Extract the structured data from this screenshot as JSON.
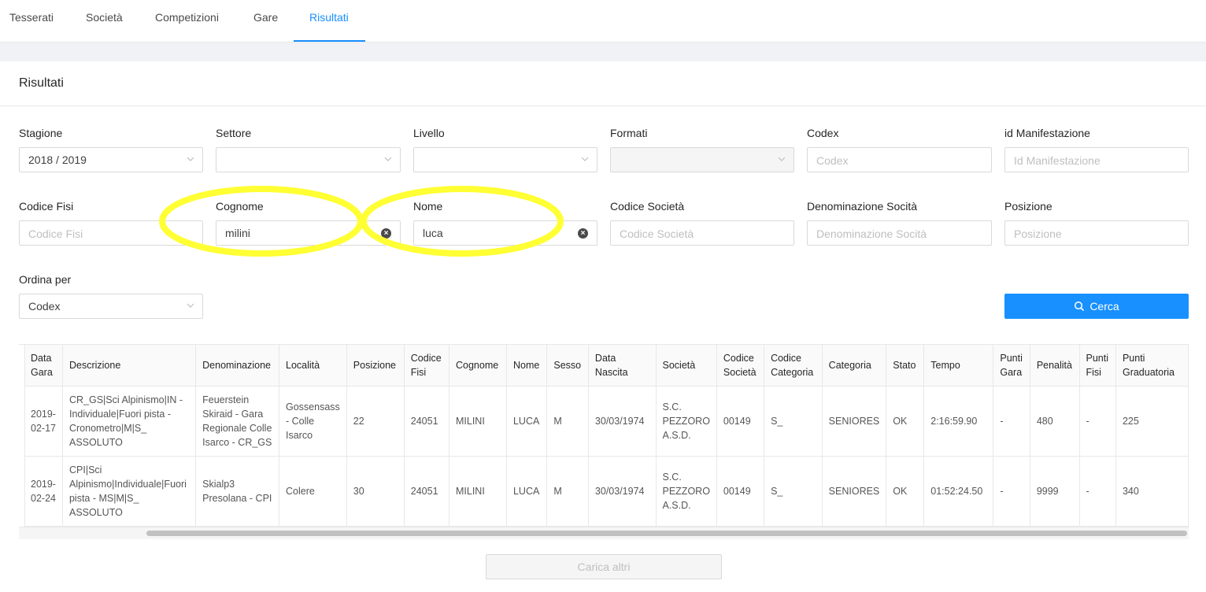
{
  "nav": {
    "tabs": [
      "Tesserati",
      "Società",
      "Competizioni",
      "Gare",
      "Risultati"
    ],
    "active": "Risultati"
  },
  "section_title": "Risultati",
  "filters": {
    "stagione": {
      "label": "Stagione",
      "value": "2018 / 2019"
    },
    "settore": {
      "label": "Settore",
      "value": ""
    },
    "livello": {
      "label": "Livello",
      "value": ""
    },
    "formati": {
      "label": "Formati",
      "value": ""
    },
    "codex": {
      "label": "Codex",
      "placeholder": "Codex"
    },
    "id_manifestazione": {
      "label": "id Manifestazione",
      "placeholder": "Id Manifestazione"
    },
    "codice_fisi": {
      "label": "Codice Fisi",
      "placeholder": "Codice Fisi"
    },
    "cognome": {
      "label": "Cognome",
      "value": "milini"
    },
    "nome": {
      "label": "Nome",
      "value": "luca"
    },
    "codice_societa": {
      "label": "Codice Società",
      "placeholder": "Codice Società"
    },
    "denominazione_societa": {
      "label": "Denominazione Socità",
      "placeholder": "Denominazione Socità"
    },
    "posizione": {
      "label": "Posizione",
      "placeholder": "Posizione"
    },
    "ordina_per": {
      "label": "Ordina per",
      "value": "Codex"
    }
  },
  "search_button": "Cerca",
  "table": {
    "headers": [
      "Data Gara",
      "Descrizione",
      "Denominazione",
      "Località",
      "Posizione",
      "Codice Fisi",
      "Cognome",
      "Nome",
      "Sesso",
      "Data Nascita",
      "Società",
      "Codice Società",
      "Codice Categoria",
      "Categoria",
      "Stato",
      "Tempo",
      "Punti Gara",
      "Penalità",
      "Punti Fisi",
      "Punti Graduatoria"
    ],
    "rows": [
      [
        "2019-02-17",
        "CR_GS|Sci Alpinismo|IN - Individuale|Fuori pista - Cronometro|M|S_ ASSOLUTO",
        "Feuerstein Skiraid - Gara Regionale Colle Isarco - CR_GS",
        "Gossensass - Colle Isarco",
        "22",
        "24051",
        "MILINI",
        "LUCA",
        "M",
        "30/03/1974",
        "S.C. PEZZORO A.S.D.",
        "00149",
        "S_",
        "SENIORES",
        "OK",
        "2:16:59.90",
        "-",
        "480",
        "-",
        "225"
      ],
      [
        "2019-02-24",
        "CPI|Sci Alpinismo|Individuale|Fuori pista - MS|M|S_ ASSOLUTO",
        "Skialp3 Presolana - CPI",
        "Colere",
        "30",
        "24051",
        "MILINI",
        "LUCA",
        "M",
        "30/03/1974",
        "S.C. PEZZORO A.S.D.",
        "00149",
        "S_",
        "SENIORES",
        "OK",
        "01:52:24.50",
        "-",
        "9999",
        "-",
        "340"
      ]
    ]
  },
  "load_more": "Carica altri",
  "colors": {
    "accent": "#1890ff",
    "highlight": "#ffff33"
  }
}
